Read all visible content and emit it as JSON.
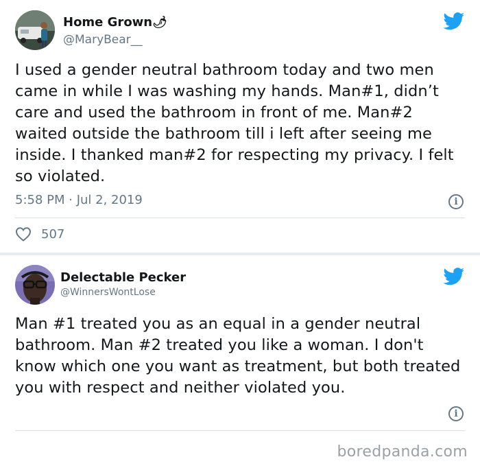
{
  "tweets": [
    {
      "display_name": "Home Grown",
      "name_emoji": "🌶",
      "handle": "@MaryBear__",
      "text": "I used a gender neutral bathroom today and two men came in while I was washing my hands. Man#1, didn’t care and used the bathroom in front of me. Man#2 waited outside the bathroom till i left after seeing me inside. I thanked man#2 for respecting my privacy. I felt so violated.",
      "timestamp": "5:58 PM · Jul 2, 2019",
      "likes": "507",
      "info_icon": "i"
    },
    {
      "display_name": "Delectable Pecker",
      "handle": "@WinnersWontLose",
      "text": "Man #1 treated you as an equal in a gender neutral bathroom. Man #2 treated you like a woman. I don't know which one you want as treatment, but both treated you with respect and neither violated you.",
      "info_icon": "i"
    }
  ],
  "colors": {
    "twitter_blue": "#1da1f2",
    "secondary_text": "#657786",
    "primary_text": "#14171a"
  },
  "icons": [
    "twitter-bird-icon",
    "info-icon",
    "heart-icon"
  ],
  "footer": {
    "watermark": "boredpanda.com"
  }
}
